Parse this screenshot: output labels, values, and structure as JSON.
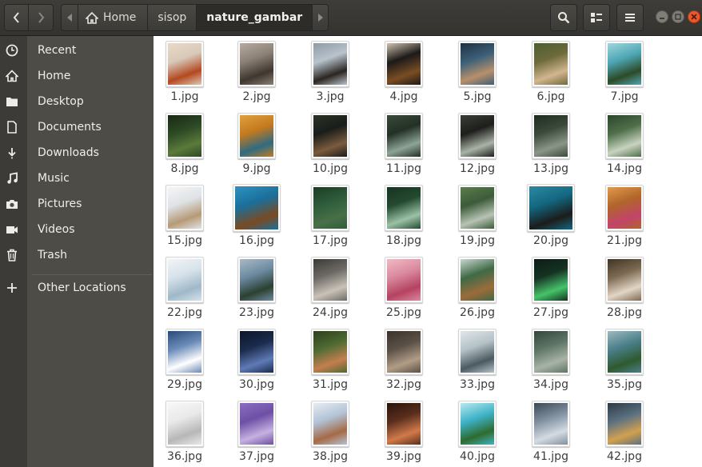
{
  "header": {
    "path": [
      "Home",
      "sisop",
      "nature_gambar"
    ],
    "back_icon": "chevron-left-icon",
    "forward_icon": "chevron-right-icon",
    "search_icon": "search-icon",
    "view_icon": "view-options-icon",
    "menu_icon": "hamburger-menu-icon",
    "close_color": "#e9592c"
  },
  "sidebar": {
    "places": [
      {
        "label": "Recent",
        "icon": "clock-icon"
      },
      {
        "label": "Home",
        "icon": "home-icon"
      },
      {
        "label": "Desktop",
        "icon": "folder-icon"
      },
      {
        "label": "Documents",
        "icon": "document-icon"
      },
      {
        "label": "Downloads",
        "icon": "download-icon"
      },
      {
        "label": "Music",
        "icon": "music-icon"
      },
      {
        "label": "Pictures",
        "icon": "camera-icon"
      },
      {
        "label": "Videos",
        "icon": "video-icon"
      },
      {
        "label": "Trash",
        "icon": "trash-icon"
      }
    ],
    "other": {
      "label": "Other Locations",
      "icon": "plus-icon"
    }
  },
  "files": [
    {
      "name": "1.jpg",
      "colors": [
        "#d8c9b8",
        "#b4481f",
        "#e8d9c8"
      ]
    },
    {
      "name": "2.jpg",
      "colors": [
        "#8a8075",
        "#3e372f",
        "#b6aba0"
      ]
    },
    {
      "name": "3.jpg",
      "colors": [
        "#b8c3cc",
        "#2b2520",
        "#8e9aa5"
      ]
    },
    {
      "name": "4.jpg",
      "colors": [
        "#1c1a18",
        "#7a4d23",
        "#cfc3b0"
      ]
    },
    {
      "name": "5.jpg",
      "colors": [
        "#3b5f78",
        "#b88f6a",
        "#1f3140"
      ]
    },
    {
      "name": "6.jpg",
      "colors": [
        "#6e6a3c",
        "#d2b68e",
        "#4b5e2f"
      ]
    },
    {
      "name": "7.jpg",
      "colors": [
        "#4ea7b5",
        "#2d4a26",
        "#9fd6dd"
      ]
    },
    {
      "name": "8.jpg",
      "colors": [
        "#2c4a24",
        "#5b7a3a",
        "#1a2815"
      ]
    },
    {
      "name": "9.jpg",
      "colors": [
        "#c47a1e",
        "#2f6b82",
        "#e0a040"
      ]
    },
    {
      "name": "10.jpg",
      "colors": [
        "#1a1d1a",
        "#7a5b3e",
        "#2a3326"
      ]
    },
    {
      "name": "11.jpg",
      "colors": [
        "#233025",
        "#8da497",
        "#3b4a3c"
      ]
    },
    {
      "name": "12.jpg",
      "colors": [
        "#1e1f1c",
        "#a9b3a6",
        "#3a3d37"
      ]
    },
    {
      "name": "13.jpg",
      "colors": [
        "#3a4a3a",
        "#8b9688",
        "#1f2a20"
      ]
    },
    {
      "name": "14.jpg",
      "colors": [
        "#4f6f4a",
        "#c8d3c0",
        "#2c452b"
      ]
    },
    {
      "name": "15.jpg",
      "colors": [
        "#dfe3e6",
        "#b69a76",
        "#f4f5f6"
      ]
    },
    {
      "name": "16.jpg",
      "colors": [
        "#1b6f9a",
        "#7a4a22",
        "#2d93c2"
      ]
    },
    {
      "name": "17.jpg",
      "colors": [
        "#2e5c3a",
        "#486f48",
        "#1c3b24"
      ]
    },
    {
      "name": "18.jpg",
      "colors": [
        "#244a30",
        "#9bc1a6",
        "#173322"
      ]
    },
    {
      "name": "19.jpg",
      "colors": [
        "#3c5b3a",
        "#b7c3b4",
        "#5c7c4c"
      ]
    },
    {
      "name": "20.jpg",
      "colors": [
        "#14677f",
        "#1c1c1a",
        "#2b8aa3"
      ]
    },
    {
      "name": "21.jpg",
      "colors": [
        "#b1652b",
        "#c2446a",
        "#e09a4c"
      ]
    },
    {
      "name": "22.jpg",
      "colors": [
        "#d6e2ea",
        "#9fb8c9",
        "#f1f5f8"
      ]
    },
    {
      "name": "23.jpg",
      "colors": [
        "#6c8aa0",
        "#2b4030",
        "#a9b9c6"
      ]
    },
    {
      "name": "24.jpg",
      "colors": [
        "#6d6a66",
        "#c9c2b8",
        "#3c3a37"
      ]
    },
    {
      "name": "25.jpg",
      "colors": [
        "#d9899e",
        "#b54261",
        "#f1b9c4"
      ]
    },
    {
      "name": "26.jpg",
      "colors": [
        "#3f6a45",
        "#9b6b3b",
        "#c7d6d0"
      ]
    },
    {
      "name": "27.jpg",
      "colors": [
        "#143222",
        "#46c36a",
        "#0c1c16"
      ]
    },
    {
      "name": "28.jpg",
      "colors": [
        "#7d6a52",
        "#e2d6c6",
        "#403426"
      ]
    },
    {
      "name": "29.jpg",
      "colors": [
        "#6b8bb8",
        "#ffffff",
        "#2a4a7a"
      ]
    },
    {
      "name": "30.jpg",
      "colors": [
        "#1b2b4d",
        "#5f7ab5",
        "#0d1629"
      ]
    },
    {
      "name": "31.jpg",
      "colors": [
        "#4e6a32",
        "#c47e4e",
        "#2d3f1c"
      ]
    },
    {
      "name": "32.jpg",
      "colors": [
        "#5a5046",
        "#b29c86",
        "#3a332c"
      ]
    },
    {
      "name": "33.jpg",
      "colors": [
        "#b5c2c8",
        "#4a5a60",
        "#e1e6e8"
      ]
    },
    {
      "name": "34.jpg",
      "colors": [
        "#5d7566",
        "#a8b3a6",
        "#33463a"
      ]
    },
    {
      "name": "35.jpg",
      "colors": [
        "#4b7f8a",
        "#2e5a2e",
        "#9cbac0"
      ]
    },
    {
      "name": "36.jpg",
      "colors": [
        "#e9e9e9",
        "#b7b7b7",
        "#f7f7f7"
      ]
    },
    {
      "name": "37.jpg",
      "colors": [
        "#6e4fa6",
        "#c5b2df",
        "#8a6ec0"
      ]
    },
    {
      "name": "38.jpg",
      "colors": [
        "#b2c3d6",
        "#a66a45",
        "#e6ecf2"
      ]
    },
    {
      "name": "39.jpg",
      "colors": [
        "#5a2e1c",
        "#d17a4a",
        "#2a130b"
      ]
    },
    {
      "name": "40.jpg",
      "colors": [
        "#3fb3c8",
        "#2e6b2e",
        "#b7e9ef"
      ]
    },
    {
      "name": "41.jpg",
      "colors": [
        "#8090a0",
        "#d4dbe2",
        "#3c4854"
      ]
    },
    {
      "name": "42.jpg",
      "colors": [
        "#5a7080",
        "#d2a050",
        "#2d3a44"
      ]
    }
  ]
}
